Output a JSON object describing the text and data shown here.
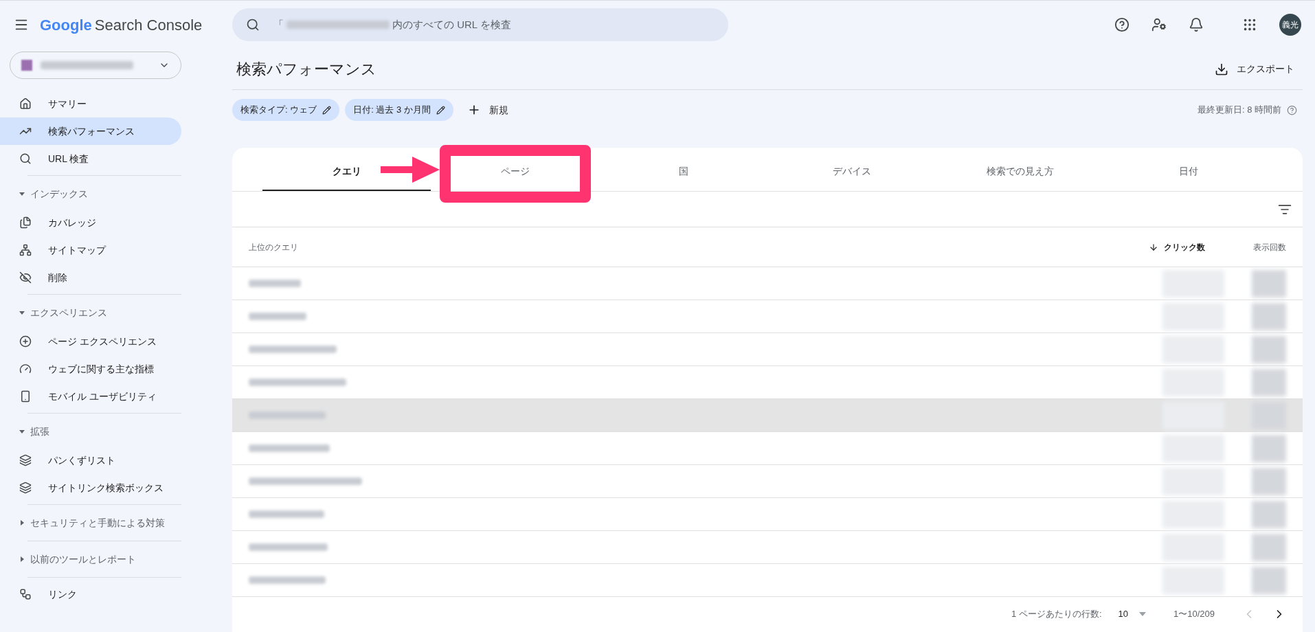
{
  "app": {
    "title_google": "Google",
    "title_rest": "Search Console"
  },
  "search": {
    "prefix": "「",
    "placeholder": "内のすべての URL を検査"
  },
  "avatar": {
    "initials": "義光"
  },
  "sidebar": {
    "top_items": [
      {
        "label": "サマリー",
        "selected": false
      },
      {
        "label": "検索パフォーマンス",
        "selected": true
      },
      {
        "label": "URL 検査",
        "selected": false
      }
    ],
    "sections": [
      {
        "title": "インデックス",
        "expanded": true,
        "items": [
          {
            "label": "カバレッジ",
            "selected": false
          },
          {
            "label": "サイトマップ",
            "selected": false
          },
          {
            "label": "削除",
            "selected": false
          }
        ]
      },
      {
        "title": "エクスペリエンス",
        "expanded": true,
        "items": [
          {
            "label": "ページ エクスペリエンス",
            "selected": false
          },
          {
            "label": "ウェブに関する主な指標",
            "selected": false
          },
          {
            "label": "モバイル ユーザビリティ",
            "selected": false
          }
        ]
      },
      {
        "title": "拡張",
        "expanded": true,
        "items": [
          {
            "label": "パンくずリスト",
            "selected": false
          },
          {
            "label": "サイトリンク検索ボックス",
            "selected": false
          }
        ]
      },
      {
        "title": "セキュリティと手動による対策",
        "expanded": false
      },
      {
        "title": "以前のツールとレポート",
        "expanded": false
      }
    ],
    "bottom_items": [
      {
        "label": "リンク",
        "selected": false
      }
    ]
  },
  "page": {
    "title": "検索パフォーマンス",
    "export": "エクスポート",
    "updated": "最終更新日: 8 時間前"
  },
  "filters": [
    {
      "label": "検索タイプ: ウェブ"
    },
    {
      "label": "日付: 過去 3 か月間"
    }
  ],
  "new_filter": "新規",
  "tabs": [
    {
      "label": "クエリ",
      "selected": true
    },
    {
      "label": "ページ",
      "selected": false
    },
    {
      "label": "国",
      "selected": false
    },
    {
      "label": "デバイス",
      "selected": false
    },
    {
      "label": "検索での見え方",
      "selected": false
    },
    {
      "label": "日付",
      "selected": false
    }
  ],
  "table": {
    "columns": [
      {
        "label": "上位のクエリ",
        "sorted": false
      },
      {
        "label": "クリック数",
        "sorted": true
      },
      {
        "label": "表示回数",
        "sorted": false
      }
    ],
    "rows": [
      {
        "highlighted": false
      },
      {
        "highlighted": false
      },
      {
        "highlighted": false
      },
      {
        "highlighted": false
      },
      {
        "highlighted": true
      },
      {
        "highlighted": false
      },
      {
        "highlighted": false
      },
      {
        "highlighted": false
      },
      {
        "highlighted": false
      },
      {
        "highlighted": false
      }
    ]
  },
  "pagination": {
    "rows_label": "1 ページあたりの行数:",
    "rows_value": "10",
    "range": "1〜10/209"
  }
}
